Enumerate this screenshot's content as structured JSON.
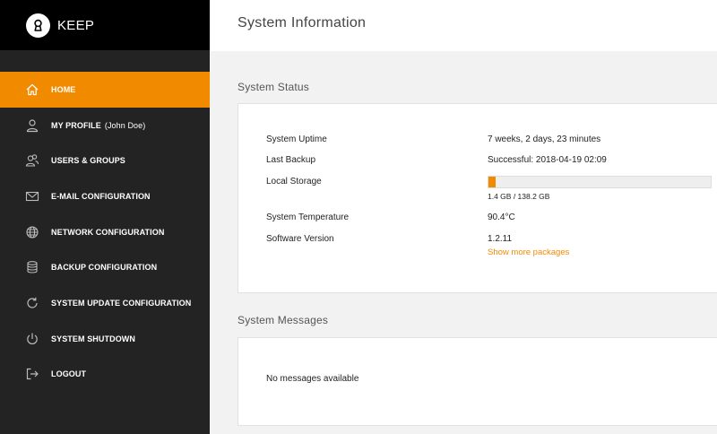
{
  "brand": {
    "name": "KEEP"
  },
  "accent_color": "#f28a00",
  "nav": {
    "items": [
      {
        "label": "HOME",
        "icon": "home-icon",
        "active": true
      },
      {
        "label": "MY PROFILE",
        "sub": "(John Doe)",
        "icon": "user-icon"
      },
      {
        "label": "USERS & GROUPS",
        "icon": "users-icon"
      },
      {
        "label": "E-MAIL CONFIGURATION",
        "icon": "mail-icon"
      },
      {
        "label": "NETWORK CONFIGURATION",
        "icon": "globe-icon"
      },
      {
        "label": "BACKUP CONFIGURATION",
        "icon": "database-icon"
      },
      {
        "label": "SYSTEM UPDATE CONFIGURATION",
        "icon": "refresh-icon"
      },
      {
        "label": "SYSTEM SHUTDOWN",
        "icon": "power-icon"
      },
      {
        "label": "LOGOUT",
        "icon": "logout-icon"
      }
    ]
  },
  "page": {
    "title": "System Information"
  },
  "status": {
    "title": "System Status",
    "uptime_label": "System Uptime",
    "uptime_value": "7 weeks, 2 days, 23 minutes",
    "backup_label": "Last Backup",
    "backup_value": "Successful: 2018-04-19 02:09",
    "storage_label": "Local Storage",
    "storage_value": "1.4 GB / 138.2 GB",
    "storage_used_fraction": 0.0101,
    "temp_label": "System Temperature",
    "temp_value": "90.4°C",
    "version_label": "Software Version",
    "version_value": "1.2.11",
    "more_packages_link": "Show more packages"
  },
  "messages": {
    "title": "System Messages",
    "empty_text": "No messages available"
  }
}
